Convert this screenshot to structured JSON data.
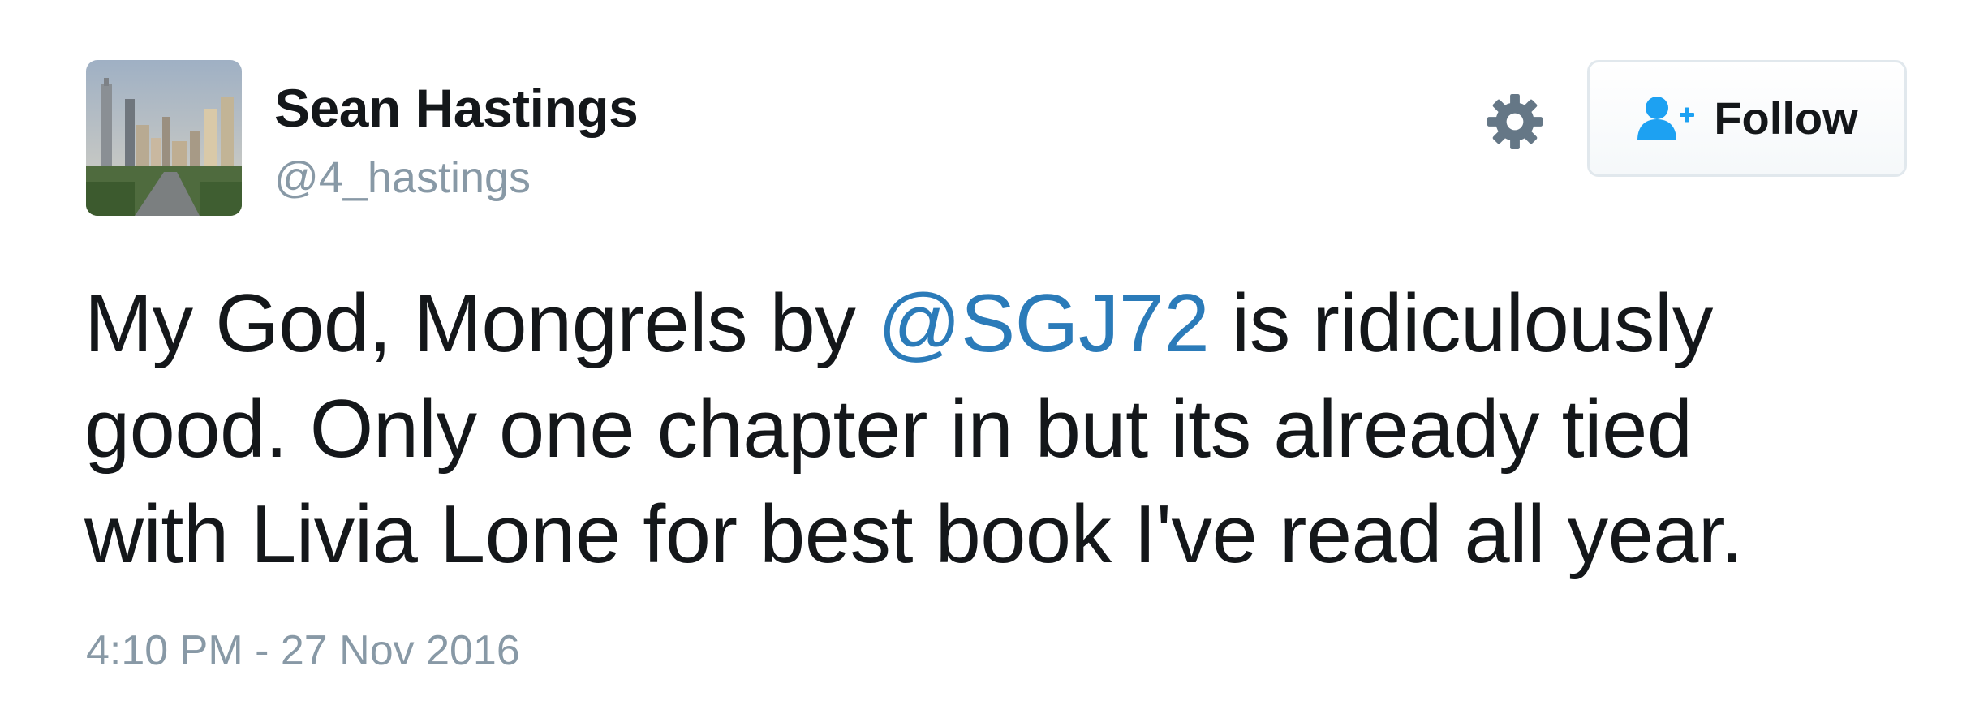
{
  "tweet": {
    "author": {
      "display_name": "Sean Hastings",
      "handle": "@4_hastings",
      "avatar_icon": "city-skyline-avatar"
    },
    "actions": {
      "settings_icon": "gear-icon",
      "follow_icon": "add-user-icon",
      "follow_label": "Follow"
    },
    "text": {
      "line1_before": "My God, Mongrels by ",
      "mention": "@SGJ72",
      "line1_after": " is ridiculously",
      "line2": "good. Only one chapter in but its already tied",
      "line3": "with Livia Lone for best book I've read all year."
    },
    "timestamp": "4:10 PM - 27 Nov 2016"
  },
  "colors": {
    "text_primary": "#14171a",
    "text_secondary": "#8899a6",
    "link": "#2b7bb9",
    "follow_icon": "#1da1f2",
    "gear": "#657786",
    "button_border": "#e1e8ed"
  }
}
